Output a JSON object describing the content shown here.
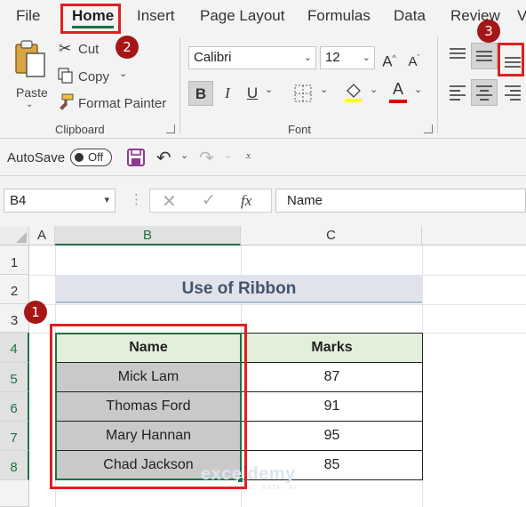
{
  "menu": {
    "tabs": [
      "File",
      "Home",
      "Insert",
      "Page Layout",
      "Formulas",
      "Data",
      "Review",
      "V"
    ]
  },
  "ribbon": {
    "clipboard": {
      "paste": "Paste",
      "cut": "Cut",
      "copy": "Copy",
      "format_painter": "Format Painter",
      "group_label": "Clipboard"
    },
    "font": {
      "name": "Calibri",
      "size": "12",
      "group_label": "Font",
      "fill_color": "#ffff00",
      "font_color": "#e00000"
    }
  },
  "qat": {
    "autosave": "AutoSave",
    "toggle": "Off"
  },
  "formula_bar": {
    "name_box": "B4",
    "fx": "fx",
    "value": "Name"
  },
  "grid": {
    "columns": [
      "A",
      "B",
      "C"
    ],
    "rows": [
      "1",
      "2",
      "3",
      "4",
      "5",
      "6",
      "7",
      "8"
    ]
  },
  "sheet": {
    "title": "Use of Ribbon",
    "headers": [
      "Name",
      "Marks"
    ],
    "records": [
      {
        "name": "Mick Lam",
        "marks": "87"
      },
      {
        "name": "Thomas Ford",
        "marks": "91"
      },
      {
        "name": "Mary Hannan",
        "marks": "95"
      },
      {
        "name": "Chad Jackson",
        "marks": "85"
      }
    ]
  },
  "annotations": [
    "1",
    "2",
    "3"
  ],
  "watermark": {
    "main": "exceldemy",
    "sub": "EXCEL · DATA · BI"
  },
  "colors": {
    "accent_green": "#1e7145",
    "annotation_red": "#e02020",
    "badge_red": "#a51616",
    "header_fill": "#e2efda",
    "selection_fill": "#c9c9c9"
  }
}
